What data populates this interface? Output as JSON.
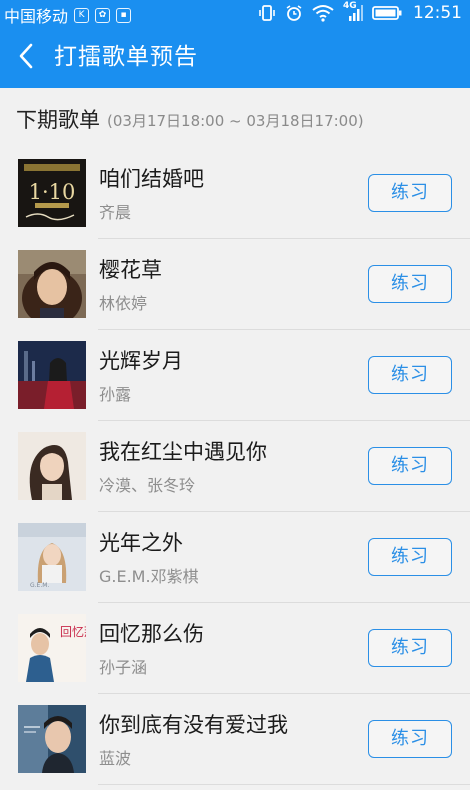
{
  "status_bar": {
    "carrier": "中国移动",
    "network": "4G",
    "time": "12:51"
  },
  "toolbar": {
    "title": "打擂歌单预告"
  },
  "section": {
    "title": "下期歌单",
    "period": "(03月17日18:00 ~ 03月18日17:00)"
  },
  "songs": [
    {
      "title": "咱们结婚吧",
      "artist": "齐晨",
      "action": "练习",
      "cover_text": "1·10"
    },
    {
      "title": "樱花草",
      "artist": "林依婷",
      "action": "练习"
    },
    {
      "title": "光辉岁月",
      "artist": "孙露",
      "action": "练习"
    },
    {
      "title": "我在红尘中遇见你",
      "artist": "冷漠、张冬玲",
      "action": "练习"
    },
    {
      "title": "光年之外",
      "artist": "G.E.M.邓紫棋",
      "action": "练习",
      "cover_text": "G.E.M."
    },
    {
      "title": "回忆那么伤",
      "artist": "孙子涵",
      "action": "练习",
      "cover_text": "回忆那么伤"
    },
    {
      "title": "你到底有没有爱过我",
      "artist": "蓝波",
      "action": "练习"
    }
  ],
  "colors": {
    "primary": "#1a8ff0",
    "button_border": "#2b8fe6",
    "background": "#f1f1f1"
  }
}
